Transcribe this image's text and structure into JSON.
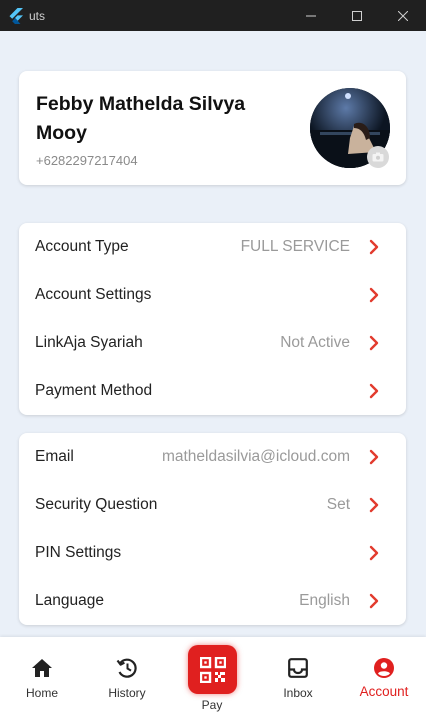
{
  "window": {
    "title": "uts"
  },
  "profile": {
    "name": "Febby Mathelda Silvya Mooy",
    "phone": "+6282297217404"
  },
  "settings_group_1": [
    {
      "label": "Account Type",
      "value": "FULL SERVICE"
    },
    {
      "label": "Account Settings",
      "value": ""
    },
    {
      "label": "LinkAja Syariah",
      "value": "Not Active"
    },
    {
      "label": "Payment Method",
      "value": ""
    }
  ],
  "settings_group_2": [
    {
      "label": "Email",
      "value": "matheldasilvia@icloud.com"
    },
    {
      "label": "Security Question",
      "value": "Set"
    },
    {
      "label": "PIN Settings",
      "value": ""
    },
    {
      "label": "Language",
      "value": "English"
    }
  ],
  "nav": {
    "home": "Home",
    "history": "History",
    "pay": "Pay",
    "inbox": "Inbox",
    "account": "Account",
    "active": "account"
  },
  "colors": {
    "accent": "#e0201f",
    "chevron": "#e23b2e",
    "background": "#eaf0f8"
  }
}
